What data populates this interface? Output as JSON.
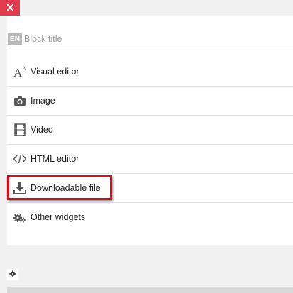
{
  "close_button": {
    "icon": "close-icon",
    "color": "#e23b4e"
  },
  "title_field": {
    "lang_badge": "EN",
    "placeholder": "Block title",
    "value": ""
  },
  "widgets": [
    {
      "label": "Visual editor",
      "icon": "text-size-icon"
    },
    {
      "label": "Image",
      "icon": "camera-icon"
    },
    {
      "label": "Video",
      "icon": "film-icon"
    },
    {
      "label": "HTML editor",
      "icon": "code-icon"
    },
    {
      "label": "Downloadable file",
      "icon": "download-icon",
      "highlighted": true,
      "highlight_color": "#d10f1d"
    },
    {
      "label": "Other widgets",
      "icon": "gears-icon"
    }
  ],
  "settings_button": {
    "icon": "gear-icon"
  }
}
